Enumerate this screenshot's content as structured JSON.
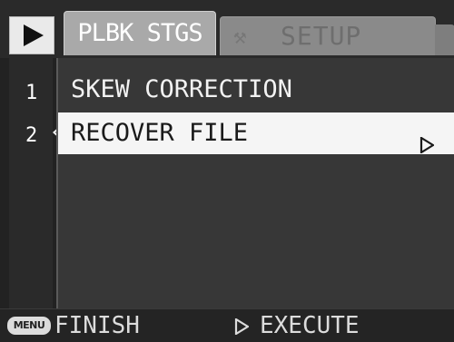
{
  "header": {
    "mode_icon": "play-icon",
    "tabs": [
      {
        "label": "PLBK STGS",
        "active": true
      },
      {
        "label": "SETUP",
        "active": false,
        "icon": "wrench-icon"
      }
    ]
  },
  "pages": [
    "1",
    "2"
  ],
  "menu": {
    "items": [
      {
        "label": "SKEW CORRECTION",
        "selected": false
      },
      {
        "label": "RECOVER FILE",
        "selected": true,
        "icon": "arrow-right-icon"
      }
    ]
  },
  "footer": {
    "menu_key": "MENU",
    "finish_label": "FINISH",
    "execute_icon": "arrow-right-icon",
    "execute_label": "EXECUTE"
  },
  "colors": {
    "highlight": "#f5f5f5",
    "active_tab": "#a9a9a9",
    "inactive_tab": "#8a8a8a",
    "panel": "#373737"
  }
}
